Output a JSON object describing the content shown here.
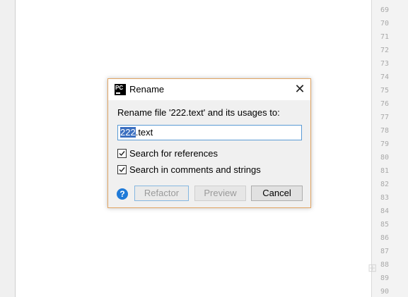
{
  "gutter": {
    "line_numbers": [
      "69",
      "70",
      "71",
      "72",
      "73",
      "74",
      "75",
      "76",
      "77",
      "78",
      "79",
      "80",
      "81",
      "82",
      "83",
      "84",
      "85",
      "86",
      "87",
      "88",
      "89",
      "90"
    ]
  },
  "dialog": {
    "app_icon_text": "PC",
    "title": "Rename",
    "close_glyph": "✕",
    "prompt": "Rename file '222.text' and its usages to:",
    "input": {
      "selected_part": "222",
      "rest": ".text"
    },
    "checkboxes": [
      {
        "label": "Search for references",
        "checked": true
      },
      {
        "label": "Search in comments and strings",
        "checked": true
      }
    ],
    "help_glyph": "?",
    "buttons": {
      "refactor": "Refactor",
      "preview": "Preview",
      "cancel": "Cancel"
    }
  },
  "colors": {
    "dialog_border": "#e1a463",
    "selection": "#3b6fc0",
    "help_icon": "#1f7ad8"
  }
}
